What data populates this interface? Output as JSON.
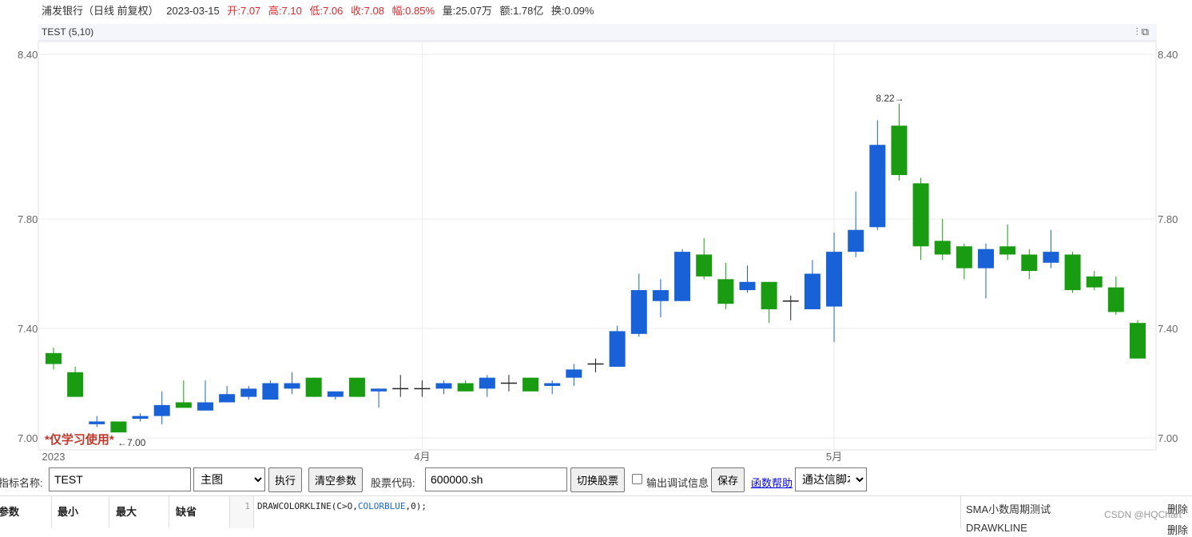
{
  "info": {
    "name": "浦发银行（日线 前复权）",
    "date": "2023-03-15",
    "open": "开:7.07",
    "high": "高:7.10",
    "low": "低:7.06",
    "close": "收:7.08",
    "range": "幅:0.85%",
    "volume": "量:25.07万",
    "amount": "额:1.78亿",
    "turnover": "换:0.09%"
  },
  "indicator": {
    "title": "TEST (5,10)",
    "icon_adjust": "settings-sliders-icon",
    "icon_switch": "switch-icon"
  },
  "chart_data": {
    "type": "candlestick",
    "y_ticks": [
      "8.40",
      "7.80",
      "7.40",
      "7.00"
    ],
    "x_ticks": [
      "2023",
      "4月",
      "5月"
    ],
    "ylim": [
      7.0,
      8.4
    ],
    "grid": true,
    "max_label": "8.22→",
    "min_label": "←7.00",
    "watermark_text": "*仅学习使用*",
    "colors": {
      "up": "#1861d6",
      "down": "#1a9c12",
      "grid": "#ebebeb",
      "axis_text": "#666"
    },
    "candles": [
      {
        "o": 7.31,
        "h": 7.33,
        "l": 7.25,
        "c": 7.27
      },
      {
        "o": 7.24,
        "h": 7.26,
        "l": 7.15,
        "c": 7.15
      },
      {
        "o": 7.05,
        "h": 7.08,
        "l": 7.04,
        "c": 7.06
      },
      {
        "o": 7.06,
        "h": 7.06,
        "l": 7.02,
        "c": 7.02
      },
      {
        "o": 7.07,
        "h": 7.09,
        "l": 7.06,
        "c": 7.08
      },
      {
        "o": 7.08,
        "h": 7.17,
        "l": 7.05,
        "c": 7.12
      },
      {
        "o": 7.13,
        "h": 7.21,
        "l": 7.11,
        "c": 7.11
      },
      {
        "o": 7.1,
        "h": 7.21,
        "l": 7.1,
        "c": 7.13
      },
      {
        "o": 7.13,
        "h": 7.19,
        "l": 7.13,
        "c": 7.16
      },
      {
        "o": 7.15,
        "h": 7.19,
        "l": 7.14,
        "c": 7.18
      },
      {
        "o": 7.14,
        "h": 7.21,
        "l": 7.14,
        "c": 7.2
      },
      {
        "o": 7.18,
        "h": 7.24,
        "l": 7.16,
        "c": 7.2
      },
      {
        "o": 7.22,
        "h": 7.22,
        "l": 7.15,
        "c": 7.15
      },
      {
        "o": 7.15,
        "h": 7.17,
        "l": 7.14,
        "c": 7.17
      },
      {
        "o": 7.22,
        "h": 7.22,
        "l": 7.15,
        "c": 7.15
      },
      {
        "o": 7.17,
        "h": 7.18,
        "l": 7.11,
        "c": 7.18
      },
      {
        "o": 7.18,
        "h": 7.23,
        "l": 7.15,
        "c": 7.18
      },
      {
        "o": 7.18,
        "h": 7.21,
        "l": 7.15,
        "c": 7.18
      },
      {
        "o": 7.18,
        "h": 7.21,
        "l": 7.16,
        "c": 7.2
      },
      {
        "o": 7.2,
        "h": 7.21,
        "l": 7.17,
        "c": 7.17
      },
      {
        "o": 7.18,
        "h": 7.23,
        "l": 7.15,
        "c": 7.22
      },
      {
        "o": 7.2,
        "h": 7.23,
        "l": 7.17,
        "c": 7.2
      },
      {
        "o": 7.22,
        "h": 7.22,
        "l": 7.17,
        "c": 7.17
      },
      {
        "o": 7.19,
        "h": 7.21,
        "l": 7.16,
        "c": 7.2
      },
      {
        "o": 7.22,
        "h": 7.27,
        "l": 7.19,
        "c": 7.25
      },
      {
        "o": 7.27,
        "h": 7.29,
        "l": 7.24,
        "c": 7.27
      },
      {
        "o": 7.26,
        "h": 7.41,
        "l": 7.26,
        "c": 7.39
      },
      {
        "o": 7.38,
        "h": 7.6,
        "l": 7.37,
        "c": 7.54
      },
      {
        "o": 7.5,
        "h": 7.58,
        "l": 7.44,
        "c": 7.54
      },
      {
        "o": 7.5,
        "h": 7.69,
        "l": 7.5,
        "c": 7.68
      },
      {
        "o": 7.67,
        "h": 7.73,
        "l": 7.58,
        "c": 7.59
      },
      {
        "o": 7.58,
        "h": 7.64,
        "l": 7.47,
        "c": 7.49
      },
      {
        "o": 7.54,
        "h": 7.63,
        "l": 7.53,
        "c": 7.57
      },
      {
        "o": 7.57,
        "h": 7.57,
        "l": 7.42,
        "c": 7.47
      },
      {
        "o": 7.5,
        "h": 7.52,
        "l": 7.43,
        "c": 7.5
      },
      {
        "o": 7.47,
        "h": 7.65,
        "l": 7.47,
        "c": 7.6
      },
      {
        "o": 7.48,
        "h": 7.75,
        "l": 7.35,
        "c": 7.68
      },
      {
        "o": 7.68,
        "h": 7.9,
        "l": 7.66,
        "c": 7.76
      },
      {
        "o": 7.77,
        "h": 8.16,
        "l": 7.76,
        "c": 8.07
      },
      {
        "o": 8.14,
        "h": 8.22,
        "l": 7.94,
        "c": 7.96
      },
      {
        "o": 7.93,
        "h": 7.95,
        "l": 7.65,
        "c": 7.7
      },
      {
        "o": 7.72,
        "h": 7.8,
        "l": 7.65,
        "c": 7.67
      },
      {
        "o": 7.7,
        "h": 7.71,
        "l": 7.58,
        "c": 7.62
      },
      {
        "o": 7.62,
        "h": 7.71,
        "l": 7.51,
        "c": 7.69
      },
      {
        "o": 7.7,
        "h": 7.78,
        "l": 7.65,
        "c": 7.67
      },
      {
        "o": 7.67,
        "h": 7.69,
        "l": 7.58,
        "c": 7.61
      },
      {
        "o": 7.64,
        "h": 7.76,
        "l": 7.62,
        "c": 7.68
      },
      {
        "o": 7.67,
        "h": 7.68,
        "l": 7.53,
        "c": 7.54
      },
      {
        "o": 7.59,
        "h": 7.61,
        "l": 7.54,
        "c": 7.55
      },
      {
        "o": 7.55,
        "h": 7.59,
        "l": 7.45,
        "c": 7.46
      },
      {
        "o": 7.42,
        "h": 7.43,
        "l": 7.29,
        "c": 7.29
      }
    ]
  },
  "controls": {
    "name_label": "指标名称:",
    "name_value": "TEST",
    "mode_value": "主图",
    "run_label": "执行",
    "clear_label": "清空参数",
    "code_label": "股票代码:",
    "code_value": "600000.sh",
    "switch_label": "切换股票",
    "debug_label": "输出调试信息",
    "save_label": "保存",
    "help_label": "函数帮助",
    "script_value": "通达信脚本"
  },
  "params": {
    "headers": [
      "参数",
      "最小",
      "最大",
      "缺省"
    ]
  },
  "editor": {
    "line_no": "1",
    "code_parts": [
      "DRAWCOLORKLINE(C>O,",
      "COLORBLUE",
      ",0);"
    ]
  },
  "side": {
    "items": [
      "SMA小数周期测试",
      "DRAWKLINE"
    ],
    "delete_label": "删除",
    "watermark": "CSDN @HQChart"
  }
}
